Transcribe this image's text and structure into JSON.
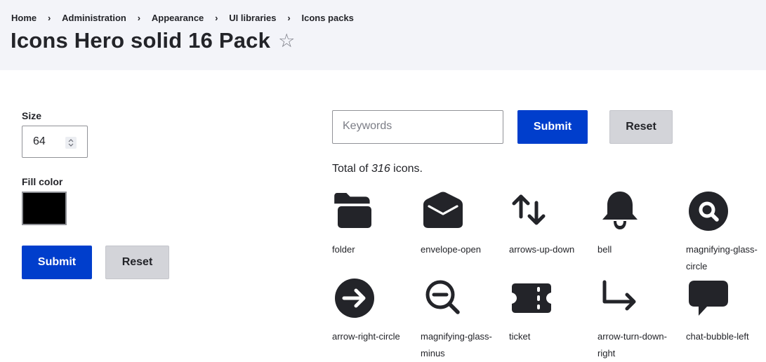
{
  "breadcrumb": [
    {
      "label": "Home"
    },
    {
      "label": "Administration"
    },
    {
      "label": "Appearance"
    },
    {
      "label": "UI libraries"
    },
    {
      "label": "Icons packs"
    }
  ],
  "breadcrumb_separator": "›",
  "page_title": "Icons Hero solid 16 Pack",
  "star_glyph": "☆",
  "settings_form": {
    "size_label": "Size",
    "size_value": "64",
    "fill_label": "Fill color",
    "fill_color": "#000000",
    "submit_label": "Submit",
    "reset_label": "Reset"
  },
  "filter_form": {
    "keywords_placeholder": "Keywords",
    "keywords_value": "",
    "submit_label": "Submit",
    "reset_label": "Reset"
  },
  "total": {
    "prefix": "Total of ",
    "count": "316",
    "suffix": " icons."
  },
  "icons": [
    {
      "label": "folder",
      "icon": "folder-icon"
    },
    {
      "label": "envelope-open",
      "icon": "envelope-open-icon"
    },
    {
      "label": "arrows-up-down",
      "icon": "arrows-up-down-icon"
    },
    {
      "label": "bell",
      "icon": "bell-icon"
    },
    {
      "label": "magnifying-glass-circle",
      "icon": "magnifying-glass-circle-icon"
    },
    {
      "label": "arrow-right-circle",
      "icon": "arrow-right-circle-icon"
    },
    {
      "label": "magnifying-glass-minus",
      "icon": "magnifying-glass-minus-icon"
    },
    {
      "label": "ticket",
      "icon": "ticket-icon"
    },
    {
      "label": "arrow-turn-down-right",
      "icon": "arrow-turn-down-right-icon"
    },
    {
      "label": "chat-bubble-left",
      "icon": "chat-bubble-left-icon"
    }
  ],
  "colors": {
    "primary": "#003ecc",
    "secondary_button": "#d3d4d9",
    "header_bg": "#f3f4f9",
    "text": "#232429",
    "icon_fill": "#232429"
  }
}
